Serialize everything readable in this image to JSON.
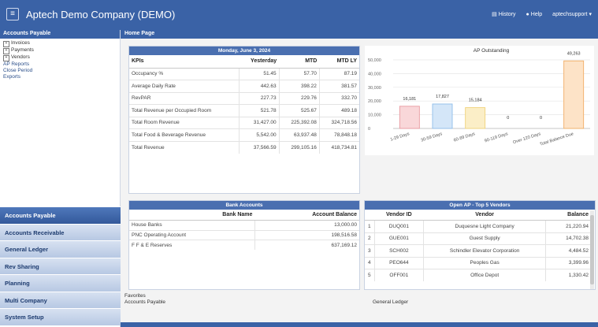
{
  "app": {
    "title": "Aptech Demo Company (DEMO)",
    "menu_icon": "hamburger-icon"
  },
  "top_links": {
    "history": "History",
    "help": "Help",
    "user": "aptechsupport ▾"
  },
  "sidebar": {
    "header": "Accounts Payable",
    "links": [
      {
        "label": "Invoices",
        "expandable": true
      },
      {
        "label": "Payments",
        "expandable": true
      },
      {
        "label": "Vendors",
        "expandable": true
      },
      {
        "label": "AP Reports",
        "expandable": false
      },
      {
        "label": "Close Period",
        "expandable": false
      },
      {
        "label": "Exports",
        "expandable": false
      }
    ],
    "modules": [
      "Accounts Payable",
      "Accounts Receivable",
      "General Ledger",
      "Rev Sharing",
      "Planning",
      "Multi Company",
      "System Setup"
    ]
  },
  "main": {
    "header": "Home Page"
  },
  "kpi": {
    "date": "Monday, June 3, 2024",
    "columns": [
      "KPIs",
      "Yesterday",
      "MTD",
      "MTD LY"
    ],
    "rows": [
      [
        "Occupancy %",
        "51.45",
        "57.70",
        "87.19"
      ],
      [
        "Average Daily Rate",
        "442.63",
        "398.22",
        "381.57"
      ],
      [
        "RevPAR",
        "227.73",
        "229.76",
        "332.70"
      ],
      [
        "Total Revenue per Occupied Room",
        "521.78",
        "525.67",
        "489.18"
      ],
      [
        "Total Room Revenue",
        "31,427.00",
        "225,392.08",
        "324,718.56"
      ],
      [
        "Total Food & Beverage Revenue",
        "5,542.00",
        "63,937.48",
        "78,848.18"
      ],
      [
        "Total Revenue",
        "37,566.59",
        "299,105.16",
        "418,734.81"
      ]
    ]
  },
  "chart_data": {
    "type": "bar",
    "title": "AP Outstanding",
    "categories": [
      "1-29 Days",
      "30-59 Days",
      "60-89 Days",
      "90-119 Days",
      "Over 120 Days",
      "Total Balance Due"
    ],
    "values": [
      16181,
      17827,
      15184,
      0,
      0,
      49263
    ],
    "data_labels": [
      "16,181",
      "17,827",
      "15,184",
      "0",
      "0",
      "49,263"
    ],
    "ylim": [
      0,
      50000
    ],
    "yticks": [
      "0",
      "10,000",
      "20,000",
      "30,000",
      "40,000",
      "50,000"
    ],
    "grid": true,
    "colors": {
      "fill": [
        "#f9d7d9",
        "#d4e6f8",
        "#fbeec7",
        "#dde8d3",
        "#e5e5e5",
        "#fde3c7"
      ],
      "stroke": [
        "#e9999f",
        "#8fbde9",
        "#f0d27a",
        "#a9c69a",
        "#bbbbbb",
        "#f2ad64"
      ]
    }
  },
  "bank": {
    "title": "Bank Accounts",
    "columns": [
      "Bank Name",
      "Account Balance"
    ],
    "rows": [
      [
        "House Banks",
        "13,000.00"
      ],
      [
        "PNC Operating Account",
        "198,516.58"
      ],
      [
        "F F & E Reserves",
        "637,169.12"
      ]
    ]
  },
  "vendors": {
    "title": "Open AP - Top 5 Vendors",
    "columns": [
      "",
      "Vendor ID",
      "Vendor",
      "Balance"
    ],
    "rows": [
      [
        "1",
        "DUQ001",
        "Duquesne Light Company",
        "21,220.94"
      ],
      [
        "2",
        "GUE001",
        "Guest Supply",
        "14,702.38"
      ],
      [
        "3",
        "SCH002",
        "Schindler Elevator Corporation",
        "4,484.52"
      ],
      [
        "4",
        "PEO644",
        "Peoples Gas",
        "3,399.96"
      ],
      [
        "5",
        "OFF001",
        "Office Depot",
        "1,330.42"
      ]
    ]
  },
  "favorites": {
    "label": "Favorites",
    "left": "Accounts Payable",
    "right": "General Ledger"
  }
}
